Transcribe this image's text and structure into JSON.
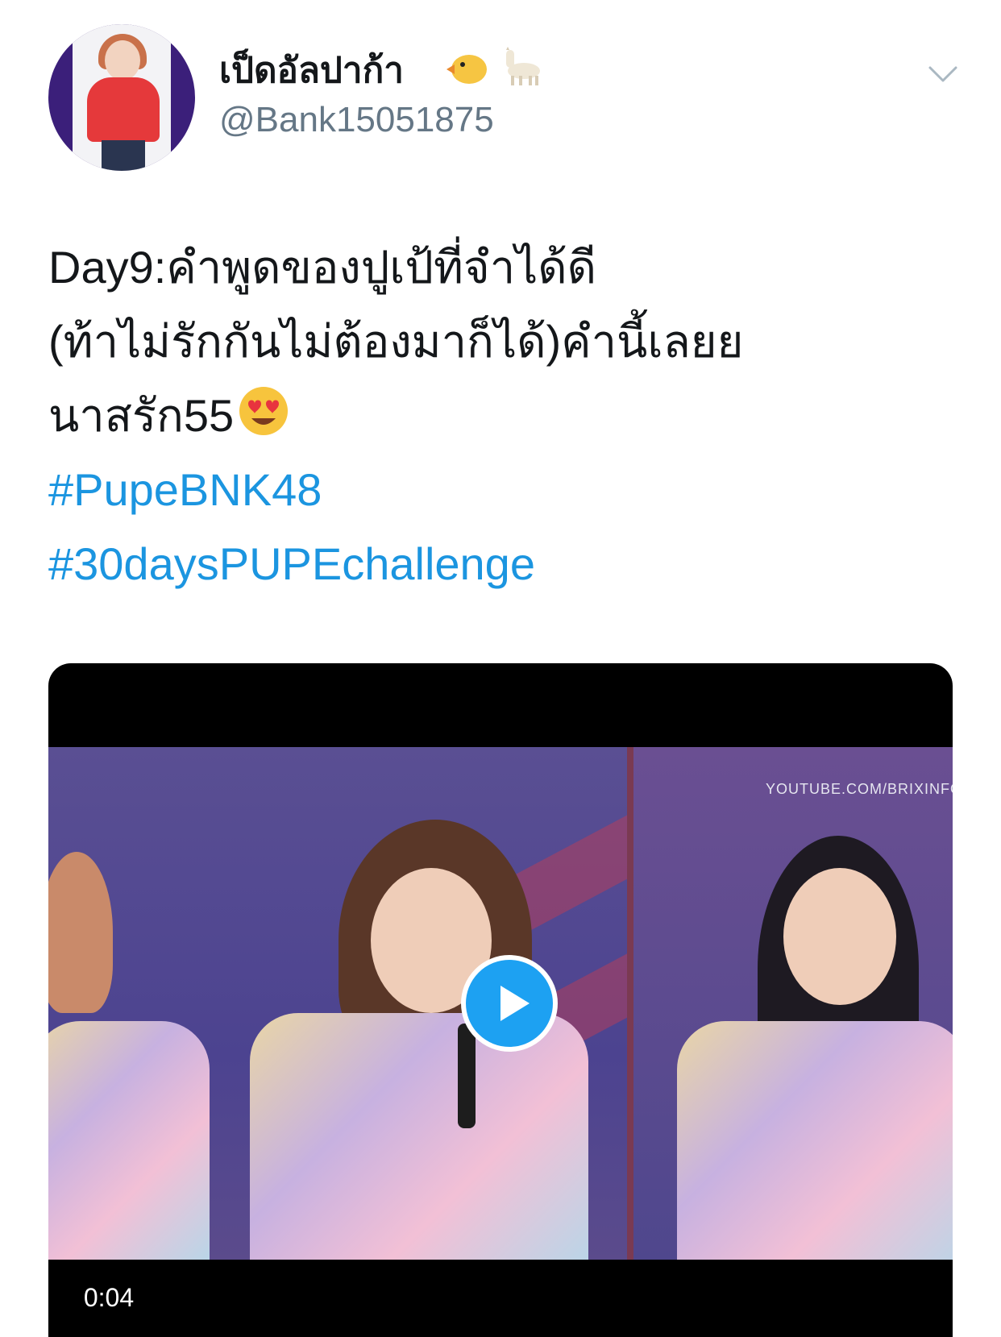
{
  "author": {
    "display_name": "เป็ดอัลปาก้า",
    "name_emojis": [
      "duck-emoji",
      "llama-emoji"
    ],
    "handle": "@Bank15051875",
    "avatar_icon": "avatar"
  },
  "tweet": {
    "text_lines": [
      "Day9:คำพูดของปูเป้ที่จำได้ดี",
      " (ท้าไม่รักกันไม่ต้องมาก็ได้)คำนี้เลยย",
      "นาสรัก55"
    ],
    "trailing_emoji": "heart-eyes-emoji",
    "hashtags": [
      "#PupeBNK48",
      "#30daysPUPEchallenge"
    ]
  },
  "media": {
    "watermark": "YOUTUBE.COM/BRIXINFO",
    "duration": "0:04",
    "play_icon": "play-icon"
  },
  "colors": {
    "hashtag": "#1b95e0",
    "handle": "#657786",
    "text": "#14171a",
    "play_button": "#1da1f2"
  },
  "menu_icon": "chevron-down-icon"
}
